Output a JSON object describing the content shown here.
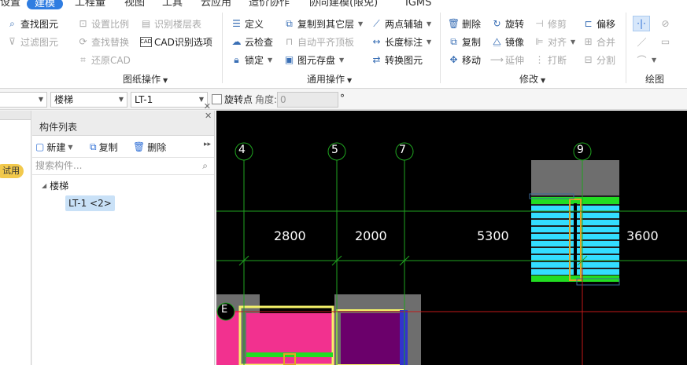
{
  "menu": {
    "items": [
      "设置",
      "建模",
      "工程量",
      "视图",
      "工具",
      "云应用",
      "造价协作",
      "协同建模(限免)",
      "IGMS"
    ],
    "active": "建模"
  },
  "ribbon": {
    "drawing_ops": {
      "find_element": "查找图元",
      "filter_element": "过滤图元",
      "set_scale": "设置比例",
      "find_replace": "查找替换",
      "restore_cad": "还原CAD",
      "identify_floors": "识别楼层表",
      "cad_identify_options": "CAD识别选项",
      "label": "图纸操作"
    },
    "general_ops": {
      "define": "定义",
      "cloud_check": "云检查",
      "lock": "锁定",
      "copy_to_other_floor": "复制到其它层",
      "auto_flat_top": "自动平齐顶板",
      "save_element": "图元存盘",
      "two_point_axis": "两点辅轴",
      "length_dim": "长度标注",
      "convert_element": "转换图元",
      "label": "通用操作"
    },
    "modify": {
      "delete": "删除",
      "copy": "复制",
      "move": "移动",
      "rotate": "旋转",
      "mirror": "镜像",
      "extend": "延伸",
      "trim": "修剪",
      "align": "对齐",
      "break": "打断",
      "offset": "偏移",
      "merge": "合并",
      "split": "分割",
      "label": "修改"
    },
    "draw": {
      "label": "绘图"
    }
  },
  "propbar": {
    "combo1": "",
    "combo2": "楼梯",
    "combo3": "LT-1",
    "rotate_point_label": "旋转点",
    "angle_label": "角度:",
    "angle_value": "0",
    "degree": "°"
  },
  "left_panel": {
    "trial_badge": "试用"
  },
  "component_list": {
    "title": "构件列表",
    "new": "新建",
    "copy": "复制",
    "delete": "删除",
    "search_placeholder": "搜索构件...",
    "tree_root": "楼梯",
    "tree_item": "LT-1 <2>"
  },
  "canvas": {
    "axis_labels": [
      "4",
      "5",
      "7",
      "9"
    ],
    "row_axis_label": "E",
    "dimensions": [
      "2800",
      "2000",
      "5300",
      "3600"
    ],
    "colors": {
      "background": "#000000",
      "grid_green": "#1fa31f",
      "axis_red": "#c21818",
      "wall_gray": "#6e6e6e",
      "stair_cyan": "#33ddff",
      "stair_green": "#22dd22",
      "slab_pink": "#f2318f",
      "slab_purple": "#6b006b",
      "outline_yellow": "#f5f36a",
      "highlight_orange": "#e2a623"
    }
  }
}
